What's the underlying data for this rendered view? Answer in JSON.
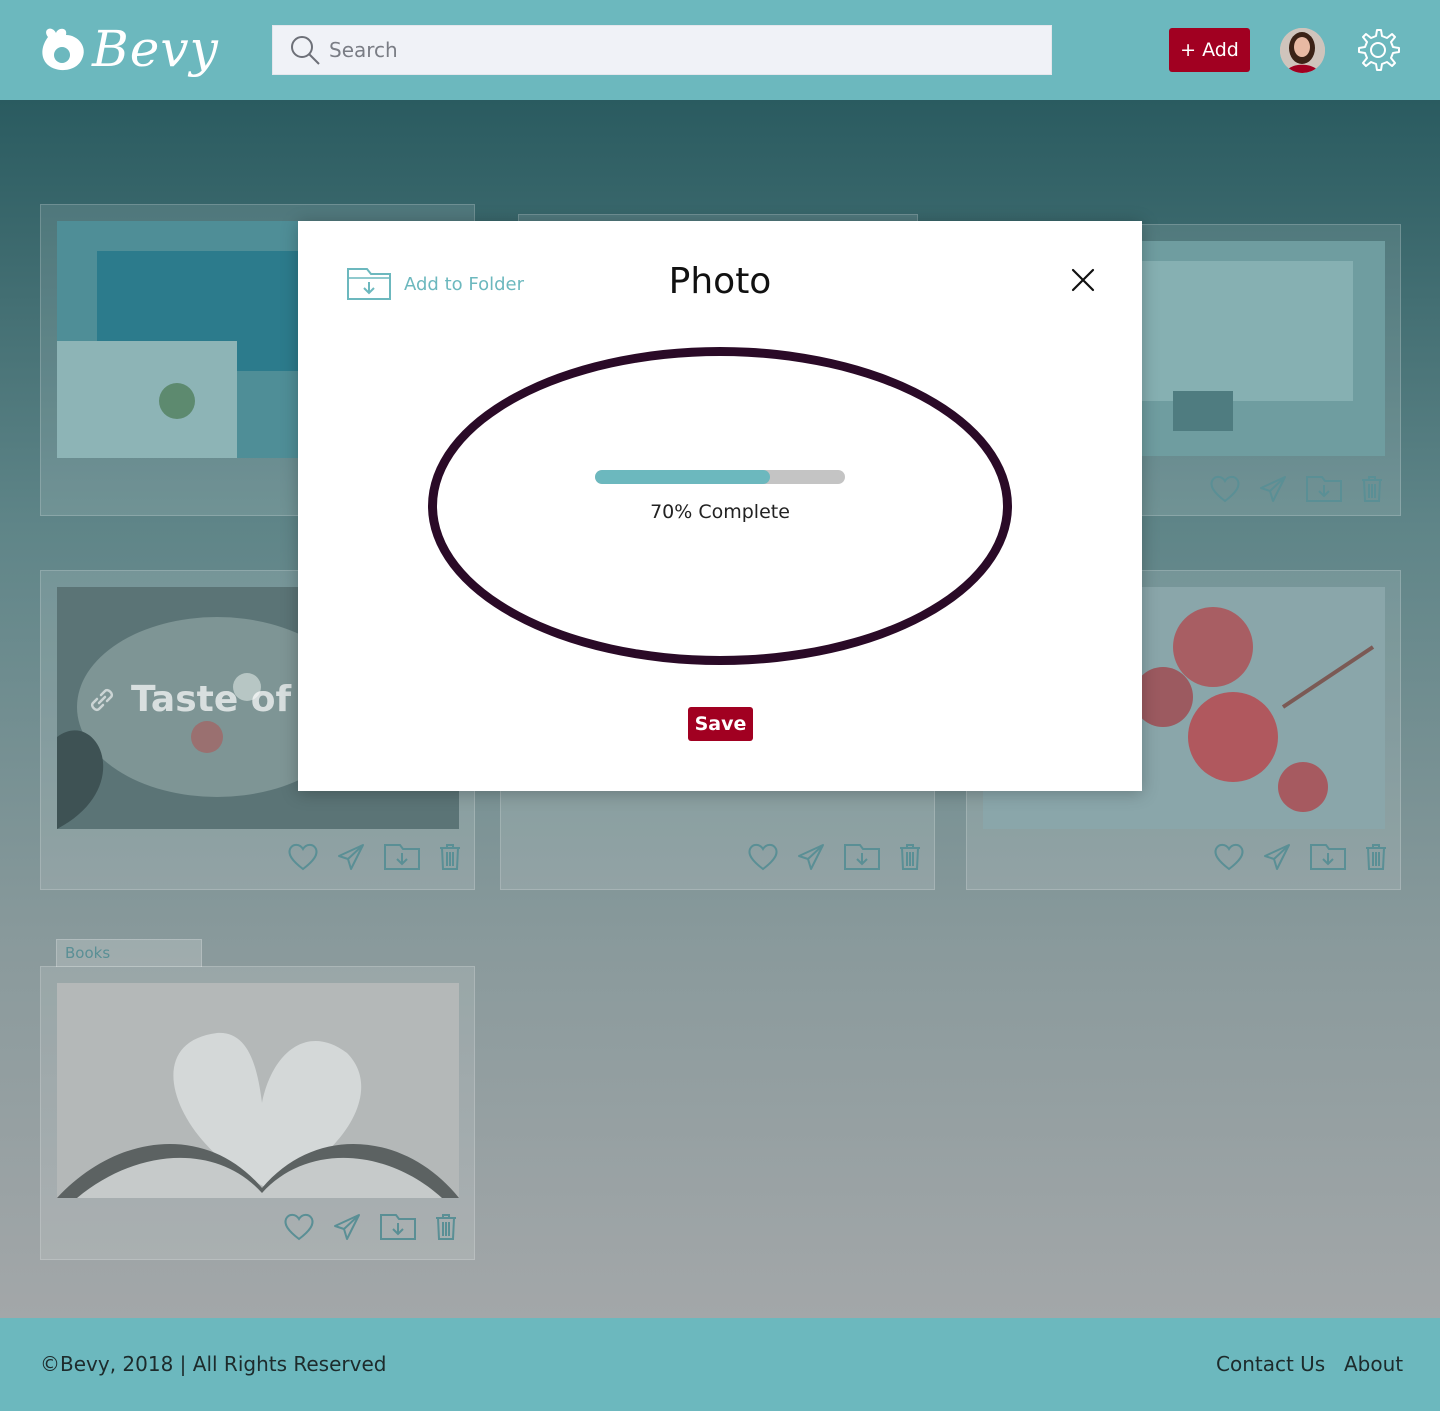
{
  "header": {
    "logo_text": "Bevy",
    "search_placeholder": "Search",
    "add_label": "+ Add"
  },
  "board": {
    "card_title": "Taste of H",
    "books_tab": "Books"
  },
  "modal": {
    "folder_label": "Add to Folder",
    "title": "Photo",
    "progress_percent": 70,
    "progress_text": "70% Complete",
    "save_label": "Save"
  },
  "footer": {
    "copyright": "©Bevy, 2018 | All Rights Reserved",
    "contact": "Contact Us",
    "about": "About"
  },
  "colors": {
    "brand_teal": "#6cb8be",
    "accent_red": "#a10021",
    "ellipse_stroke": "#2a0a27"
  }
}
